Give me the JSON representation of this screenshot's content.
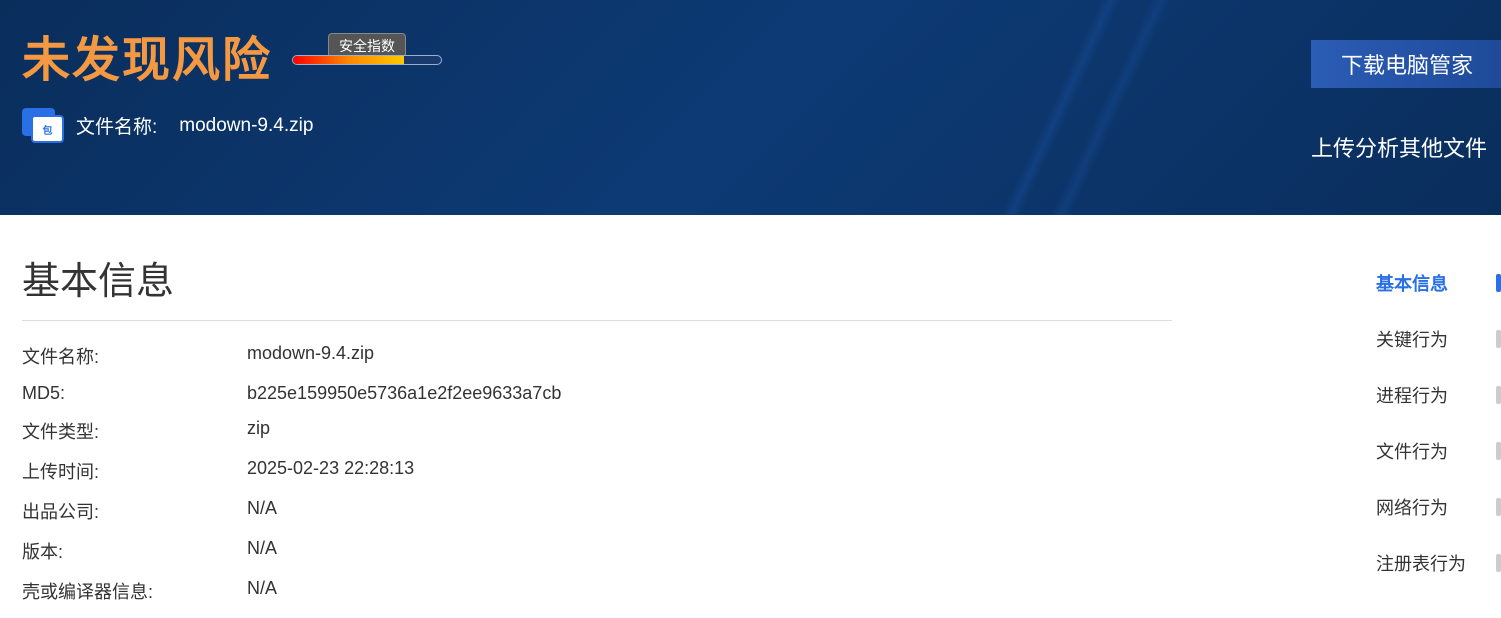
{
  "header": {
    "risk_status": "未发现风险",
    "gauge_label": "安全指数",
    "file_label": "文件名称:",
    "file_name": "modown-9.4.zip",
    "download_btn": "下载电脑管家",
    "upload_btn": "上传分析其他文件"
  },
  "section": {
    "title": "基本信息"
  },
  "info": {
    "rows": [
      {
        "key": "文件名称:",
        "val": "modown-9.4.zip"
      },
      {
        "key": "MD5:",
        "val": "b225e159950e5736a1e2f2ee9633a7cb"
      },
      {
        "key": "文件类型:",
        "val": "zip"
      },
      {
        "key": "上传时间:",
        "val": "2025-02-23 22:28:13"
      },
      {
        "key": "出品公司:",
        "val": "N/A"
      },
      {
        "key": "版本:",
        "val": "N/A"
      },
      {
        "key": "壳或编译器信息:",
        "val": "N/A"
      }
    ]
  },
  "nav": {
    "items": [
      {
        "label": "基本信息",
        "active": true
      },
      {
        "label": "关键行为",
        "active": false
      },
      {
        "label": "进程行为",
        "active": false
      },
      {
        "label": "文件行为",
        "active": false
      },
      {
        "label": "网络行为",
        "active": false
      },
      {
        "label": "注册表行为",
        "active": false
      }
    ]
  }
}
